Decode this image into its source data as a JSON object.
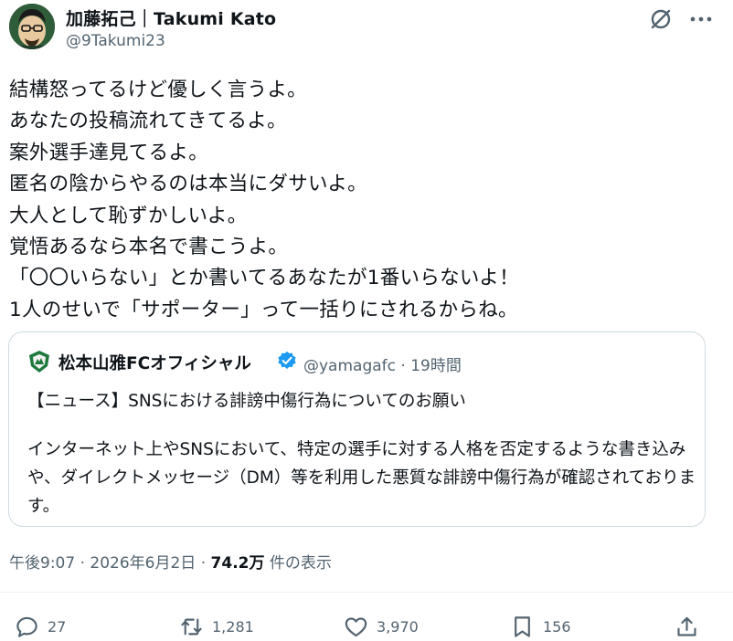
{
  "author": {
    "name": "加藤拓己｜Takumi Kato",
    "handle": "@9Takumi23"
  },
  "icons": {
    "avatar": "avatar-icon",
    "grok": "grok-icon",
    "more": "more-icon",
    "verified": "verified-badge-icon",
    "quote_logo": "club-crest-icon",
    "reply": "reply-icon",
    "retweet": "retweet-icon",
    "like": "heart-icon",
    "bookmark": "bookmark-icon",
    "share": "share-icon"
  },
  "tweet": {
    "lines": [
      "結構怒ってるけど優しく言うよ。",
      "あなたの投稿流れてきてるよ。",
      "案外選手達見てるよ。",
      "匿名の陰からやるのは本当にダサいよ。",
      "大人として恥ずかしいよ。",
      "覚悟あるなら本名で書こうよ。",
      "「〇〇いらない」とか書いてるあなたが1番いらないよ！",
      "1人のせいで「サポーター」って一括りにされるからね。"
    ]
  },
  "quote": {
    "name": "松本山雅FCオフィシャル",
    "handle": "@yamagafc",
    "separator": "·",
    "time": "19時間",
    "title": "【ニュース】SNSにおける誹謗中傷行為についてのお願い",
    "body": "インターネット上やSNSにおいて、特定の選手に対する人格を否定するような書き込みや、ダイレクトメッセージ（DM）等を利用した悪質な誹謗中傷行為が確認されております。"
  },
  "meta": {
    "time": "午後9:07",
    "sep1": "·",
    "date": "2026年6月2日",
    "sep2": "·",
    "views": "74.2万",
    "views_label": "件の表示"
  },
  "actions": {
    "replies": "27",
    "retweets": "1,281",
    "likes": "3,970",
    "bookmarks": "156"
  },
  "colors": {
    "text": "#0f1419",
    "secondary": "#536471",
    "border": "#cfd9de",
    "verified": "#1d9bf0",
    "crest": "#1e7a3c"
  }
}
